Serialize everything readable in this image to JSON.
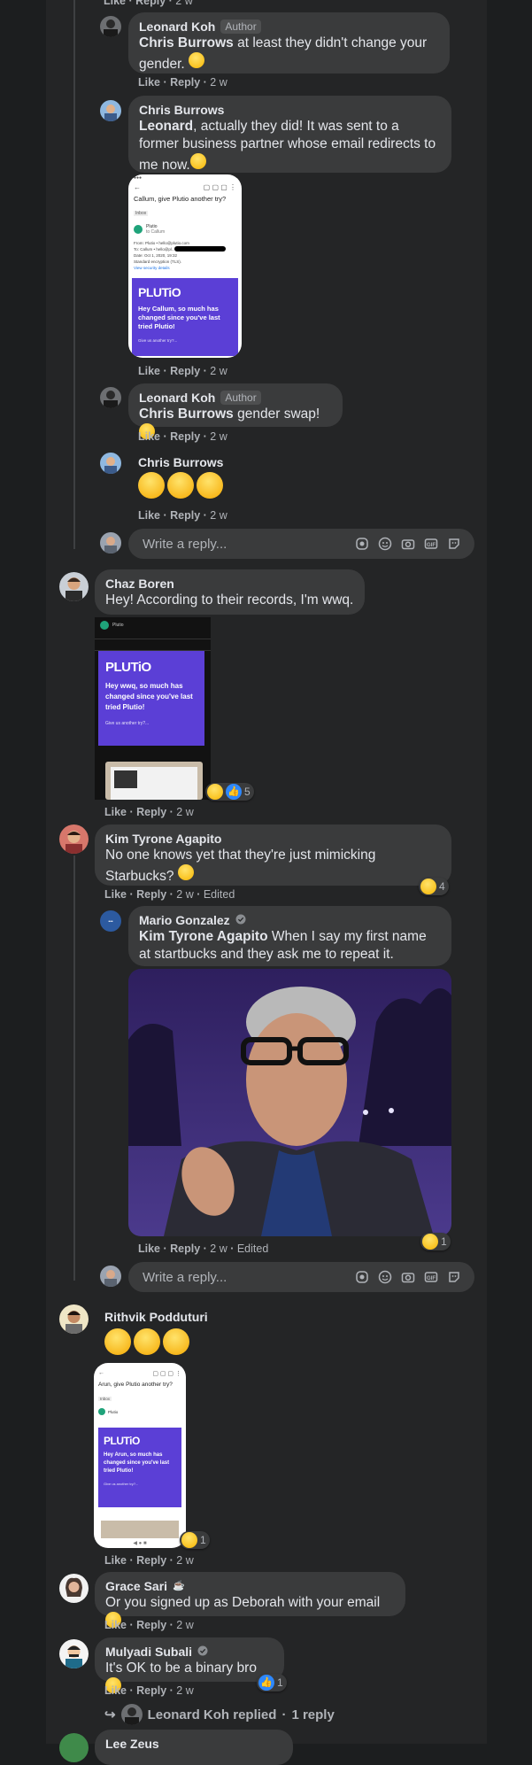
{
  "common": {
    "like": "Like",
    "reply": "Reply",
    "age": "2 w",
    "edited": "Edited",
    "dot": "·",
    "author_badge": "Author"
  },
  "reply_box": {
    "placeholder": "Write a reply..."
  },
  "comments": {
    "c0": {
      "name": "Leonard Koh",
      "tag": "Chris Burrows",
      "text": " at least they didn't change your gender."
    },
    "c1": {
      "name": "Chris Burrows",
      "tag": "Leonard",
      "text": ", actually they did! It was sent to a former business partner whose email redirects to me now."
    },
    "c2": {
      "name": "Leonard Koh",
      "tag": "Chris Burrows",
      "text": " gender swap!"
    },
    "c3": {
      "name": "Chris Burrows"
    },
    "c4": {
      "name": "Chaz Boren",
      "text": "Hey! According to their records, I'm wwq.",
      "reaction_count": "5"
    },
    "c5": {
      "name": "Kim Tyrone Agapito",
      "text": "No one knows yet that they're just mimicking Starbucks?",
      "reaction_count": "4"
    },
    "c6": {
      "name": "Mario Gonzalez",
      "tag": "Kim Tyrone Agapito",
      "text": " When I say my first name at startbucks and they ask me to repeat it.",
      "reaction_count": "1"
    },
    "c7": {
      "name": "Rithvik Podduturi",
      "reaction_count": "1"
    },
    "c8": {
      "name": "Grace Sari",
      "text": "Or you signed up as Deborah with your email"
    },
    "c9": {
      "name": "Mulyadi Subali",
      "text": "It's OK to be a binary bro",
      "reaction_count": "1",
      "replied_by": "Leonard Koh replied",
      "reply_count": "1 reply"
    },
    "c10": {
      "name": "Lee Zeus"
    }
  },
  "email_shot_1": {
    "subject": "Callum, give Plutio another try?",
    "label": "Inbox",
    "sender": "Plutio",
    "to_line": "to Callum",
    "from_row": "From: Plutio • hello@plutio.com",
    "to_row": "To: Callum • hello@pl...",
    "date_row": "Date: Oct 1, 2020, 19:32",
    "enc_row": "Standard encryption (TLS).",
    "details_link": "View security details",
    "logo": "PLUTiO",
    "headline": "Hey Callum, so much has changed since you've last tried Plutio!",
    "cta": "Give us another try?..."
  },
  "email_shot_2": {
    "sender": "Plutio",
    "logo": "PLUTiO",
    "headline": "Hey wwq, so much has changed since you've last tried Plutio!",
    "cta": "Give us another try?..."
  },
  "email_shot_3": {
    "subject": "Arun, give Plutio another try?",
    "label": "Inbox",
    "sender": "Plutio",
    "logo": "PLUTiO",
    "headline": "Hey Arun, so much has changed since you've last tried Plutio!",
    "cta": "Give us another try?..."
  },
  "colors": {
    "background": "#1c1e1f",
    "panel": "#242526",
    "bubble": "#3a3b3c",
    "text": "#e4e6eb",
    "meta": "#b0b3b8",
    "plutio_purple": "#5b3fd6",
    "like_blue": "#2d88ff"
  }
}
